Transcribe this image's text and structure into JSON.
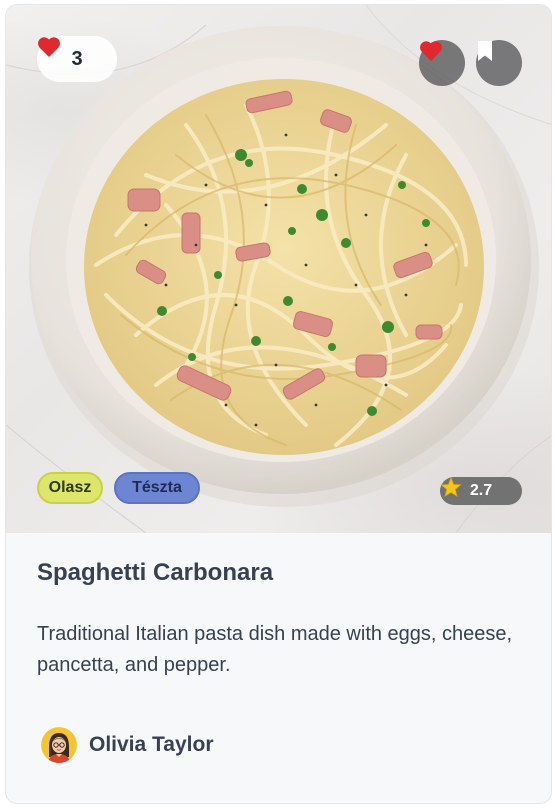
{
  "recipe": {
    "title": "Spaghetti Carbonara",
    "description": "Traditional Italian pasta dish made with eggs, cheese, pancetta, and pepper.",
    "likes_count": "3",
    "rating": "2.7",
    "tags": [
      "Olasz",
      "Tészta"
    ]
  },
  "author": {
    "name": "Olivia Taylor",
    "avatar_icon": "woman-avatar-icon"
  },
  "icons": {
    "likes": "heart-icon",
    "favorite": "heart-icon",
    "bookmark": "bookmark-icon",
    "rating": "star-icon"
  },
  "colors": {
    "heart": "#e0282e",
    "star": "#f5c518",
    "tag_olasz": "#dde66a",
    "tag_teszta": "#6d86d4"
  }
}
